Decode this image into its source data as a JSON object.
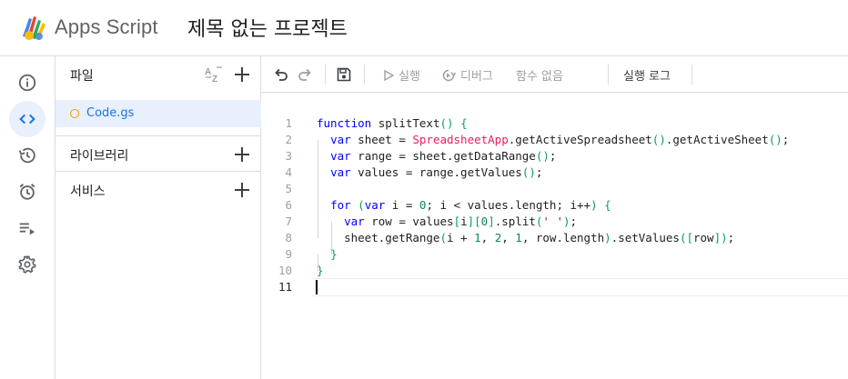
{
  "header": {
    "app_name": "Apps Script",
    "project_title": "제목 없는 프로젝트"
  },
  "rail": {
    "items": [
      {
        "name": "overview",
        "icon": "info-icon"
      },
      {
        "name": "editor",
        "icon": "code-icon",
        "active": true
      },
      {
        "name": "executions",
        "icon": "history-icon"
      },
      {
        "name": "triggers",
        "icon": "alarm-icon"
      },
      {
        "name": "executions-list",
        "icon": "playlist-play-icon"
      },
      {
        "name": "settings",
        "icon": "gear-icon"
      }
    ]
  },
  "files": {
    "title": "파일",
    "items": [
      {
        "name": "Code.gs",
        "selected": true
      }
    ],
    "sections": [
      {
        "label": "라이브러리"
      },
      {
        "label": "서비스"
      }
    ]
  },
  "toolbar": {
    "run_label": "실행",
    "debug_label": "디버그",
    "function_label": "함수 없음",
    "log_label": "실행 로그"
  },
  "editor": {
    "lines": [
      {
        "no": "1",
        "code": "function splitText() {"
      },
      {
        "no": "2",
        "code": "  var sheet = SpreadsheetApp.getActiveSpreadsheet().getActiveSheet();"
      },
      {
        "no": "3",
        "code": "  var range = sheet.getDataRange();"
      },
      {
        "no": "4",
        "code": "  var values = range.getValues();"
      },
      {
        "no": "5",
        "code": ""
      },
      {
        "no": "6",
        "code": "  for (var i = 0; i < values.length; i++) {"
      },
      {
        "no": "7",
        "code": "    var row = values[i][0].split(' ');"
      },
      {
        "no": "8",
        "code": "    sheet.getRange(i + 1, 2, 1, row.length).setValues([row]);"
      },
      {
        "no": "9",
        "code": "  }"
      },
      {
        "no": "10",
        "code": "}"
      },
      {
        "no": "11",
        "code": ""
      }
    ],
    "current_line": 11
  },
  "colors": {
    "accent": "#1a73e8",
    "active_bg": "#e8f0fe",
    "file_dot": "#f29900",
    "keyword": "#0000ff",
    "class_name": "#e91e63",
    "number": "#098658",
    "string": "#a31515"
  }
}
